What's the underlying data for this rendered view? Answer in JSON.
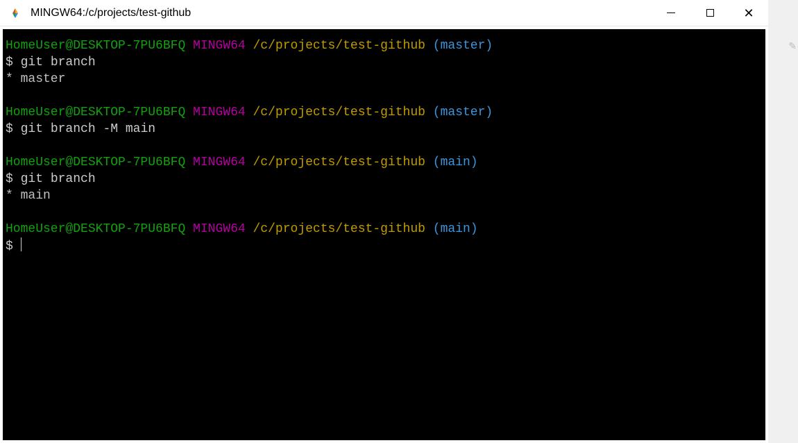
{
  "window": {
    "title": "MINGW64:/c/projects/test-github"
  },
  "prompt": {
    "user_host": "HomeUser@DESKTOP-7PU6BFQ",
    "sys": "MINGW64",
    "path": "/c/projects/test-github",
    "branch_master": "(master)",
    "branch_main": "(main)",
    "dollar": "$"
  },
  "cmd": {
    "git_branch": "git branch",
    "git_branch_M_main": "git branch -M main"
  },
  "out": {
    "star_master": "* master",
    "star_main": "* main"
  }
}
